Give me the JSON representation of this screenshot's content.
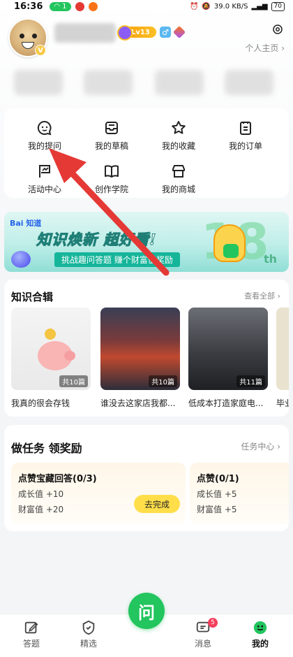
{
  "status_bar": {
    "time": "16:36",
    "pill_text": "1",
    "network_speed": "39.0 KB/S",
    "battery": "70"
  },
  "profile": {
    "level": "Lv13",
    "vip_mark": "V",
    "homepage_link": "个人主页 ›"
  },
  "quick_menu": [
    {
      "label": "我的提问",
      "icon": "question-bubble-icon"
    },
    {
      "label": "我的草稿",
      "icon": "draft-tray-icon"
    },
    {
      "label": "我的收藏",
      "icon": "star-icon"
    },
    {
      "label": "我的订单",
      "icon": "order-list-icon"
    },
    {
      "label": "活动中心",
      "icon": "flag-icon"
    },
    {
      "label": "创作学院",
      "icon": "book-icon"
    },
    {
      "label": "我的商城",
      "icon": "shop-icon"
    }
  ],
  "banner": {
    "brand": "Bai 知道",
    "headline": "知识焕新 超好看!",
    "subline": "挑战趣问答题  赚个财富值奖励",
    "big_number": "18",
    "suffix": "th"
  },
  "collections": {
    "title": "知识合辑",
    "more": "查看全部 ›",
    "items": [
      {
        "title": "我真的很会存钱",
        "count": "共10篇"
      },
      {
        "title": "谁没去这家店我都...",
        "count": "共10篇"
      },
      {
        "title": "低成本打造家庭电...",
        "count": "共11篇"
      },
      {
        "title": "毕业",
        "count": ""
      }
    ]
  },
  "tasks": {
    "title": "做任务 领奖励",
    "center_link": "任务中心 ›",
    "items": [
      {
        "name": "点赞宝藏回答(0/3)",
        "growth": "成长值 +10",
        "wealth": "财富值 +20",
        "action": "去完成"
      },
      {
        "name": "点赞(0/1)",
        "growth": "成长值 +5",
        "wealth": "财富值 +5"
      }
    ]
  },
  "bottom_nav": {
    "items": [
      {
        "label": "答题",
        "icon": "edit-icon"
      },
      {
        "label": "精选",
        "icon": "shield-icon"
      },
      {
        "label": "消息",
        "icon": "message-icon"
      },
      {
        "label": "我的",
        "icon": "smiley-icon"
      }
    ],
    "center_label": "问",
    "message_badge": "5"
  },
  "colors": {
    "accent_green": "#22c55e",
    "task_button": "#ffde4a",
    "annotation_arrow": "#e53935"
  }
}
